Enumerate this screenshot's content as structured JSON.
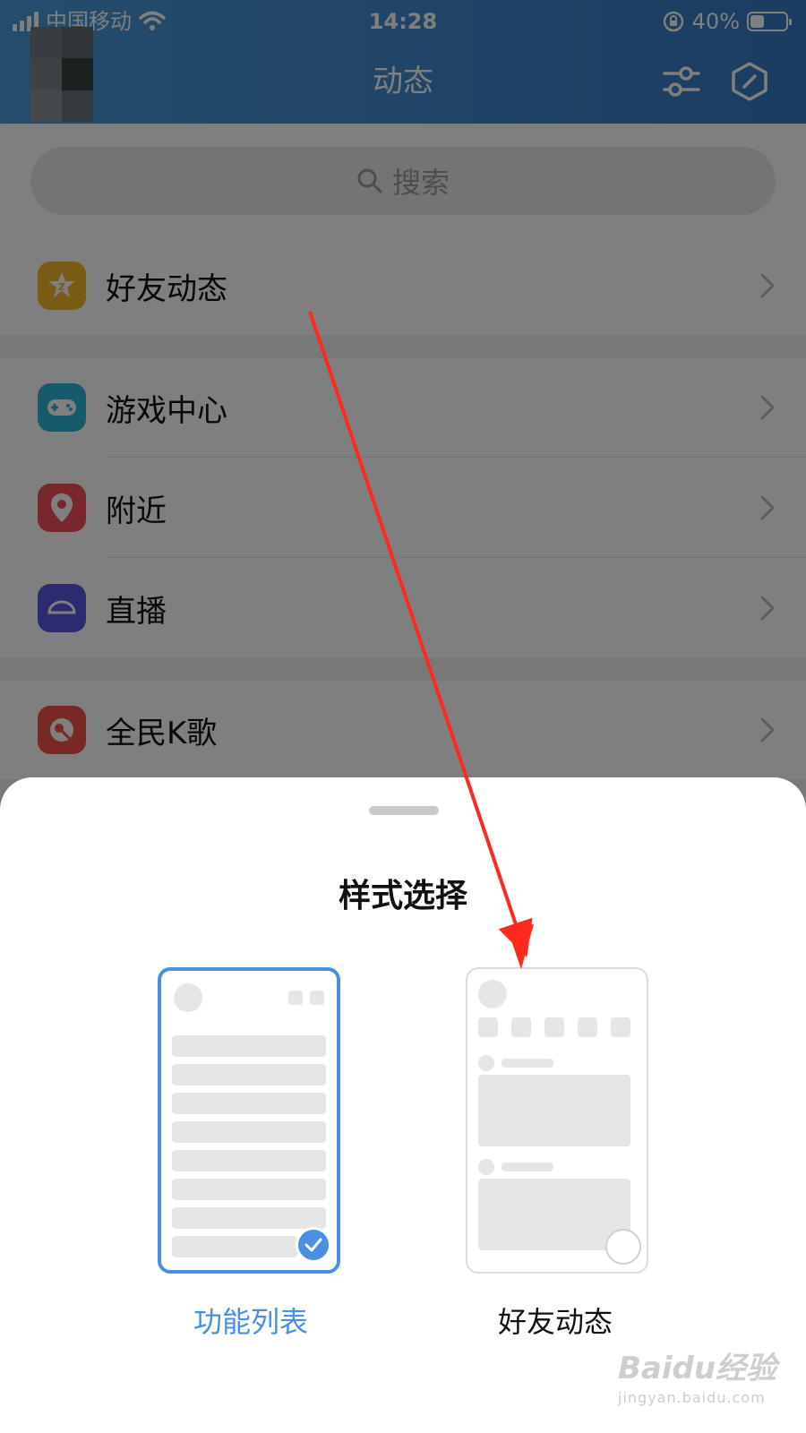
{
  "status_bar": {
    "carrier": "中国移动",
    "time": "14:28",
    "battery": "40%",
    "battery_level": 0.4
  },
  "header": {
    "title": "动态",
    "filter_icon": "sliders-icon",
    "shield_icon": "shield-icon"
  },
  "search": {
    "placeholder": "搜索"
  },
  "list": {
    "items": [
      {
        "label": "好友动态",
        "icon": "star-badge-icon",
        "color": "#f4b627"
      },
      {
        "label": "游戏中心",
        "icon": "gamepad-icon",
        "color": "#2fb5d6"
      },
      {
        "label": "附近",
        "icon": "location-pin-icon",
        "color": "#f0505a"
      },
      {
        "label": "直播",
        "icon": "live-icon",
        "color": "#5b57e0"
      },
      {
        "label": "全民K歌",
        "icon": "karaoke-icon",
        "color": "#f0514b"
      }
    ]
  },
  "sheet": {
    "title": "样式选择",
    "options": [
      {
        "label": "功能列表",
        "selected": true
      },
      {
        "label": "好友动态",
        "selected": false
      }
    ]
  },
  "colors": {
    "accent": "#4a90e2",
    "header": "#3f87cc",
    "annotation_arrow": "#ff2a1f"
  },
  "watermark": {
    "brand": "Baidu经验",
    "url": "jingyan.baidu.com"
  }
}
